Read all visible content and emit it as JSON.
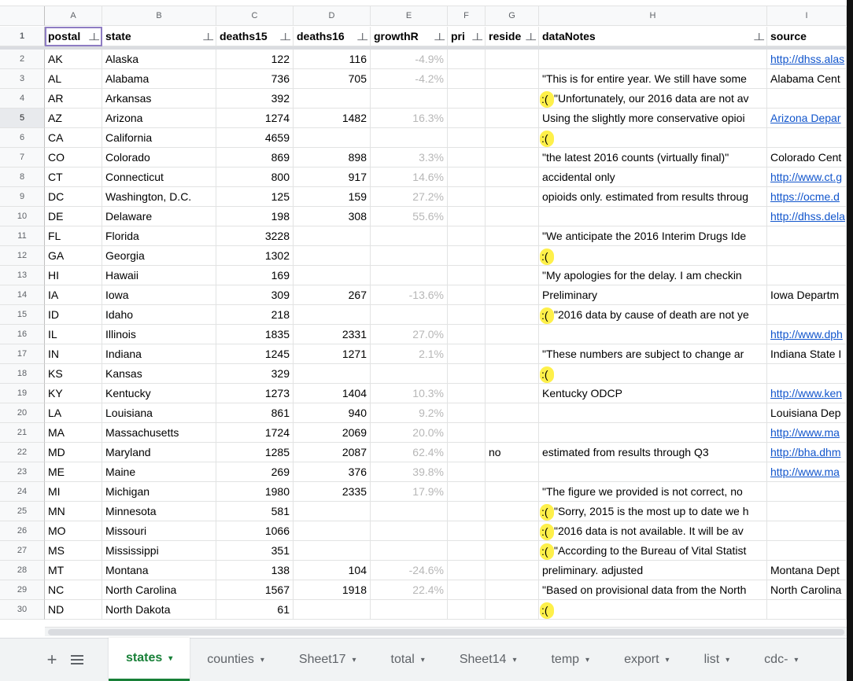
{
  "sheet": {
    "column_letters": [
      "A",
      "B",
      "C",
      "D",
      "E",
      "F",
      "G",
      "H",
      "I"
    ],
    "header": [
      "postal",
      "state",
      "deaths15",
      "deaths16",
      "growthR",
      "pri",
      "reside",
      "dataNotes",
      "source"
    ],
    "filter_icon": "filter-icon",
    "rows": [
      {
        "n": "1"
      },
      {
        "n": "2",
        "postal": "AK",
        "state": "Alaska",
        "d15": "122",
        "d16": "116",
        "g": "-4.9%",
        "pri": "",
        "res": "",
        "sad": "",
        "note": "",
        "source": "http://dhss.alas"
      },
      {
        "n": "3",
        "postal": "AL",
        "state": "Alabama",
        "d15": "736",
        "d16": "705",
        "g": "-4.2%",
        "pri": "",
        "res": "",
        "sad": "",
        "note": "\"This is for entire year. We still have some",
        "source": "Alabama Cent"
      },
      {
        "n": "4",
        "postal": "AR",
        "state": "Arkansas",
        "d15": "392",
        "d16": "",
        "g": "",
        "pri": "",
        "res": "",
        "sad": ":(",
        "note": "\"Unfortunately, our 2016 data are not av",
        "source": ""
      },
      {
        "n": "5",
        "postal": "AZ",
        "state": "Arizona",
        "d15": "1274",
        "d16": "1482",
        "g": "16.3%",
        "pri": "",
        "res": "",
        "sad": "",
        "note": "Using the slightly more conservative opioi",
        "source": "Arizona Depar"
      },
      {
        "n": "6",
        "postal": "CA",
        "state": "California",
        "d15": "4659",
        "d16": "",
        "g": "",
        "pri": "",
        "res": "",
        "sad": ":(",
        "note": "",
        "source": ""
      },
      {
        "n": "7",
        "postal": "CO",
        "state": "Colorado",
        "d15": "869",
        "d16": "898",
        "g": "3.3%",
        "pri": "",
        "res": "",
        "sad": "",
        "note": "\"the latest 2016 counts (virtually final)\"",
        "source": "Colorado Cent"
      },
      {
        "n": "8",
        "postal": "CT",
        "state": "Connecticut",
        "d15": "800",
        "d16": "917",
        "g": "14.6%",
        "pri": "",
        "res": "",
        "sad": "",
        "note": "accidental only",
        "source": "http://www.ct.g"
      },
      {
        "n": "9",
        "postal": "DC",
        "state": "Washington, D.C.",
        "d15": "125",
        "d16": "159",
        "g": "27.2%",
        "pri": "",
        "res": "",
        "sad": "",
        "note": "opioids only. estimated from results throug",
        "source": "https://ocme.d"
      },
      {
        "n": "10",
        "postal": "DE",
        "state": "Delaware",
        "d15": "198",
        "d16": "308",
        "g": "55.6%",
        "pri": "",
        "res": "",
        "sad": "",
        "note": "",
        "source": "http://dhss.dela"
      },
      {
        "n": "11",
        "postal": "FL",
        "state": "Florida",
        "d15": "3228",
        "d16": "",
        "g": "",
        "pri": "",
        "res": "",
        "sad": "",
        "note": "\"We anticipate the 2016 Interim Drugs Ide",
        "source": ""
      },
      {
        "n": "12",
        "postal": "GA",
        "state": "Georgia",
        "d15": "1302",
        "d16": "",
        "g": "",
        "pri": "",
        "res": "",
        "sad": ":(",
        "note": "",
        "source": ""
      },
      {
        "n": "13",
        "postal": "HI",
        "state": "Hawaii",
        "d15": "169",
        "d16": "",
        "g": "",
        "pri": "",
        "res": "",
        "sad": "",
        "note": "\"My apologies for the delay.  I am checkin",
        "source": ""
      },
      {
        "n": "14",
        "postal": "IA",
        "state": "Iowa",
        "d15": "309",
        "d16": "267",
        "g": "-13.6%",
        "pri": "",
        "res": "",
        "sad": "",
        "note": "Preliminary",
        "source": "Iowa Departm"
      },
      {
        "n": "15",
        "postal": "ID",
        "state": "Idaho",
        "d15": "218",
        "d16": "",
        "g": "",
        "pri": "",
        "res": "",
        "sad": ":(",
        "note": "\"2016 data by cause of death are not ye",
        "source": ""
      },
      {
        "n": "16",
        "postal": "IL",
        "state": "Illinois",
        "d15": "1835",
        "d16": "2331",
        "g": "27.0%",
        "pri": "",
        "res": "",
        "sad": "",
        "note": "",
        "source": "http://www.dph"
      },
      {
        "n": "17",
        "postal": "IN",
        "state": "Indiana",
        "d15": "1245",
        "d16": "1271",
        "g": "2.1%",
        "pri": "",
        "res": "",
        "sad": "",
        "note": "\"These numbers are subject to change ar",
        "source": "Indiana State I"
      },
      {
        "n": "18",
        "postal": "KS",
        "state": "Kansas",
        "d15": "329",
        "d16": "",
        "g": "",
        "pri": "",
        "res": "",
        "sad": ":(",
        "note": "",
        "source": ""
      },
      {
        "n": "19",
        "postal": "KY",
        "state": "Kentucky",
        "d15": "1273",
        "d16": "1404",
        "g": "10.3%",
        "pri": "",
        "res": "",
        "sad": "",
        "note": "Kentucky ODCP",
        "source": "http://www.ken"
      },
      {
        "n": "20",
        "postal": "LA",
        "state": "Louisiana",
        "d15": "861",
        "d16": "940",
        "g": "9.2%",
        "pri": "",
        "res": "",
        "sad": "",
        "note": "",
        "source": "Louisiana Dep"
      },
      {
        "n": "21",
        "postal": "MA",
        "state": "Massachusetts",
        "d15": "1724",
        "d16": "2069",
        "g": "20.0%",
        "pri": "",
        "res": "",
        "sad": "",
        "note": "",
        "source": "http://www.ma"
      },
      {
        "n": "22",
        "postal": "MD",
        "state": "Maryland",
        "d15": "1285",
        "d16": "2087",
        "g": "62.4%",
        "pri": "",
        "res": "no",
        "sad": "",
        "note": "estimated from results through Q3",
        "source": "http://bha.dhm"
      },
      {
        "n": "23",
        "postal": "ME",
        "state": "Maine",
        "d15": "269",
        "d16": "376",
        "g": "39.8%",
        "pri": "",
        "res": "",
        "sad": "",
        "note": "",
        "source": "http://www.ma"
      },
      {
        "n": "24",
        "postal": "MI",
        "state": "Michigan",
        "d15": "1980",
        "d16": "2335",
        "g": "17.9%",
        "pri": "",
        "res": "",
        "sad": "",
        "note": "\"The figure we provided is not correct, no",
        "source": ""
      },
      {
        "n": "25",
        "postal": "MN",
        "state": "Minnesota",
        "d15": "581",
        "d16": "",
        "g": "",
        "pri": "",
        "res": "",
        "sad": ":(",
        "note": "\"Sorry, 2015 is the most up to date we h",
        "source": ""
      },
      {
        "n": "26",
        "postal": "MO",
        "state": "Missouri",
        "d15": "1066",
        "d16": "",
        "g": "",
        "pri": "",
        "res": "",
        "sad": ":(",
        "note": "\"2016 data is not available.  It will be av",
        "source": ""
      },
      {
        "n": "27",
        "postal": "MS",
        "state": "Mississippi",
        "d15": "351",
        "d16": "",
        "g": "",
        "pri": "",
        "res": "",
        "sad": ":(",
        "note": "\"According to the Bureau of Vital Statist",
        "source": ""
      },
      {
        "n": "28",
        "postal": "MT",
        "state": "Montana",
        "d15": "138",
        "d16": "104",
        "g": "-24.6%",
        "pri": "",
        "res": "",
        "sad": "",
        "note": "preliminary. adjusted",
        "source": "Montana Dept"
      },
      {
        "n": "29",
        "postal": "NC",
        "state": "North Carolina",
        "d15": "1567",
        "d16": "1918",
        "g": "22.4%",
        "pri": "",
        "res": "",
        "sad": "",
        "note": "\"Based on provisional data from the North",
        "source": "North Carolina"
      },
      {
        "n": "30",
        "postal": "ND",
        "state": "North Dakota",
        "d15": "61",
        "d16": "",
        "g": "",
        "pri": "",
        "res": "",
        "sad": ":(",
        "note": "",
        "source": ""
      }
    ],
    "link_sources": [
      "http://dhss.alas",
      "Arizona Depar",
      "http://www.ct.g",
      "https://ocme.d",
      "http://dhss.dela",
      "http://www.dph",
      "http://www.ken",
      "http://www.ma",
      "http://bha.dhm"
    ]
  },
  "tabs": {
    "add_icon": "plus-icon",
    "add_label": "+",
    "list_icon": "sheet-list-icon",
    "caret": "▾",
    "items": [
      "states",
      "counties",
      "Sheet17",
      "total",
      "Sheet14",
      "temp",
      "export",
      "list",
      "cdc-"
    ],
    "active": "states"
  },
  "colors": {
    "highlight": "#fef04a",
    "link": "#1155cc",
    "active_tab": "#188038",
    "muted_percent": "#b7b7b7"
  }
}
